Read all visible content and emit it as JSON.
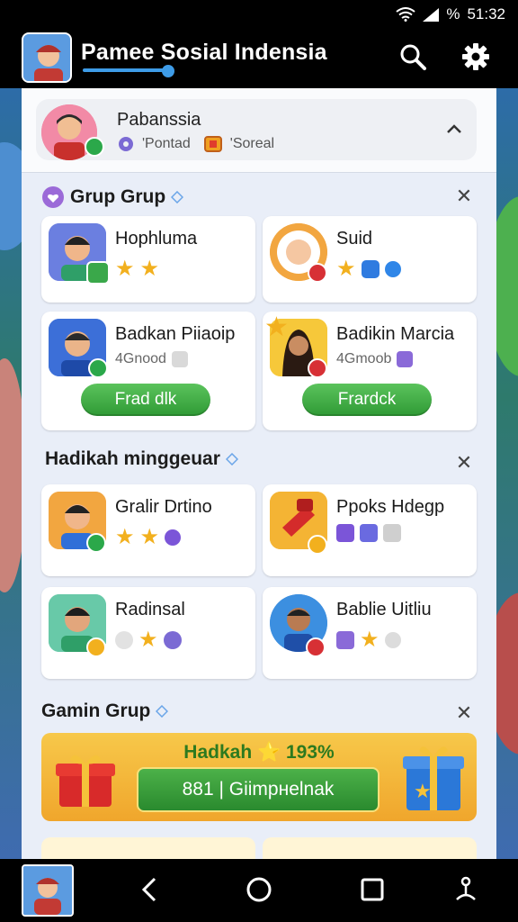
{
  "status": {
    "time": "51:32",
    "battery_text": "%"
  },
  "app": {
    "title": "Pamee Sosial Indensia",
    "accent": "#3e9ce8"
  },
  "profile": {
    "name": "Pabanssia",
    "meta1": "'Pontad",
    "meta2": "'Soreal"
  },
  "sections": {
    "grup": {
      "title": "Grup Grup"
    },
    "hadikah": {
      "title": "Hadikah minggeuar"
    },
    "gamin": {
      "title": "Gamin Grup"
    }
  },
  "cards": [
    {
      "name": "Hophluma"
    },
    {
      "name": "Suid"
    },
    {
      "name": "Badkan Piiaoip",
      "sub": "4Gnood",
      "button": "Frad dlk"
    },
    {
      "name": "Badikin Marcia",
      "sub": "4Gmoob",
      "button": "Frardck"
    },
    {
      "name": "Gralir Drtino"
    },
    {
      "name": "Ppoks Hdegp"
    },
    {
      "name": "Radinsal"
    },
    {
      "name": "Bablie Uitliu"
    }
  ],
  "promo": {
    "title": "Hadkah ⭐ 193%",
    "button": "881 | Giimpнelnak"
  },
  "icons": [
    "search-icon",
    "gear-icon",
    "close-icon",
    "chevron-up-icon",
    "back-icon",
    "home-icon",
    "recents-icon",
    "accessibility-icon"
  ]
}
